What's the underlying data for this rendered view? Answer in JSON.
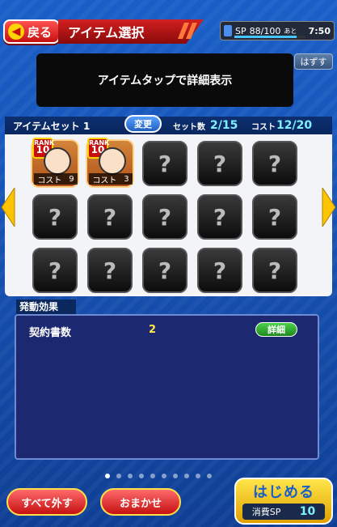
{
  "header": {
    "back_label": "戻る",
    "title": "アイテム選択",
    "sp_label": "SP",
    "sp_value": "88/100",
    "sp_suffix": "あと",
    "timer": "7:50",
    "sp_fraction": 0.88
  },
  "tooltip": {
    "text": "アイテムタップで詳細表示",
    "remove_label": "はずす"
  },
  "set": {
    "title": "アイテムセット 1",
    "change_label": "変更",
    "count_label": "セット数",
    "count_value": "2/15",
    "cost_label": "コスト",
    "cost_value": "12/20"
  },
  "items": [
    {
      "rank_label": "RANK",
      "rank": "10",
      "cost_label": "コスト",
      "cost": "9"
    },
    {
      "rank_label": "RANK",
      "rank": "10",
      "cost_label": "コスト",
      "cost": "3"
    }
  ],
  "empty_slot_symbol": "?",
  "effects": {
    "header": "発動効果",
    "rows": [
      {
        "label": "契約書数",
        "value": "2",
        "detail_label": "詳細"
      }
    ]
  },
  "pages": {
    "count": 10,
    "active": 0
  },
  "footer": {
    "remove_all": "すべて外す",
    "auto": "おまかせ",
    "start": "はじめる",
    "sp_consume_label": "消費SP",
    "sp_consume_value": "10"
  },
  "icons": {
    "back": "arrow-left-icon",
    "sp": "sp-card-icon",
    "empty": "question-mark-icon",
    "prev": "chevron-left-icon",
    "next": "chevron-right-icon"
  },
  "colors": {
    "accent_red": "#c51010",
    "accent_yellow": "#ffd400",
    "bg_blue": "#1a5fc8",
    "value_cyan": "#7ff0ff"
  }
}
